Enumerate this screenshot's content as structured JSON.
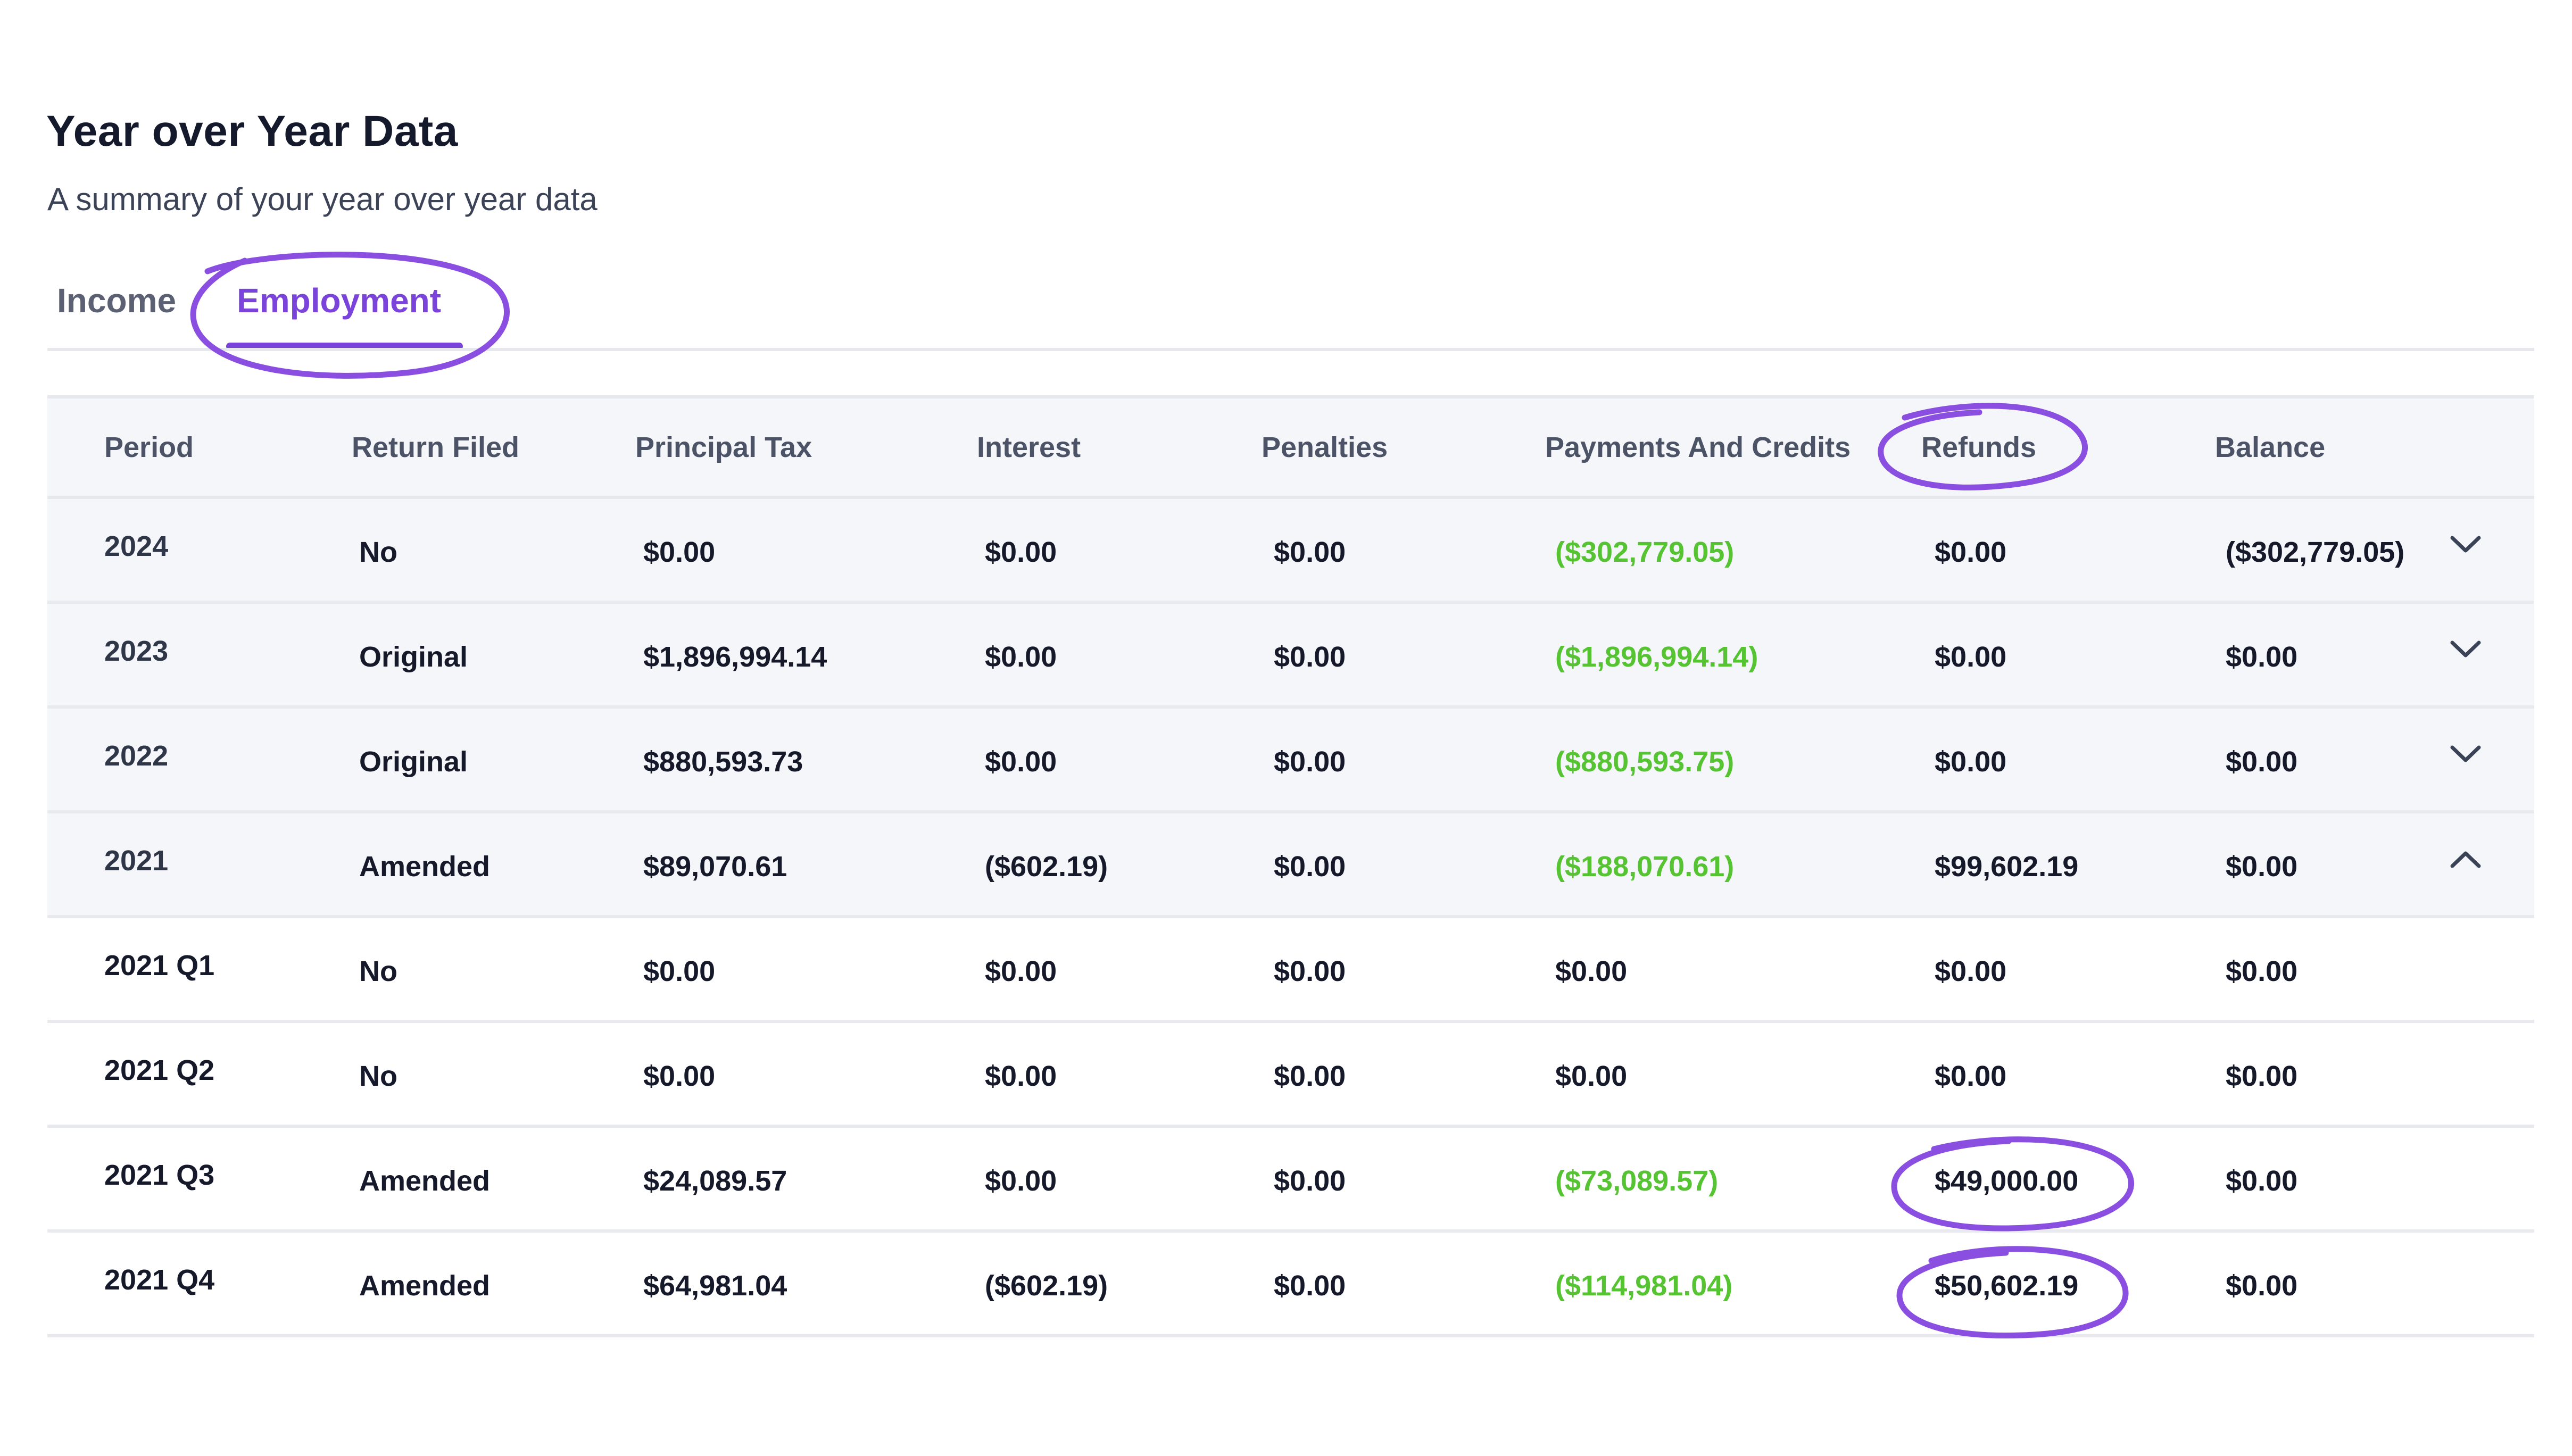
{
  "section": {
    "title": "Year over Year Data",
    "subtitle": "A summary of your year over year data"
  },
  "tabs": [
    {
      "label": "Income",
      "active": false
    },
    {
      "label": "Employment",
      "active": true
    }
  ],
  "colors": {
    "accent": "#7a44db",
    "credit_green": "#55c332",
    "annotation_circle": "#8a4fe0"
  },
  "table": {
    "columns": [
      "Period",
      "Return Filed",
      "Principal Tax",
      "Interest",
      "Penalties",
      "Payments And Credits",
      "Refunds",
      "Balance"
    ],
    "rows": [
      {
        "period": "2024",
        "return_filed": "No",
        "principal_tax": "$0.00",
        "interest": "$0.00",
        "penalties": "$0.00",
        "payments_credits": "($302,779.05)",
        "refunds": "$0.00",
        "balance": "($302,779.05)",
        "expander": "chevron-down-icon"
      },
      {
        "period": "2023",
        "return_filed": "Original",
        "principal_tax": "$1,896,994.14",
        "interest": "$0.00",
        "penalties": "$0.00",
        "payments_credits": "($1,896,994.14)",
        "refunds": "$0.00",
        "balance": "$0.00",
        "expander": "chevron-down-icon"
      },
      {
        "period": "2022",
        "return_filed": "Original",
        "principal_tax": "$880,593.73",
        "interest": "$0.00",
        "penalties": "$0.00",
        "payments_credits": "($880,593.75)",
        "refunds": "$0.00",
        "balance": "$0.00",
        "expander": "chevron-down-icon"
      },
      {
        "period": "2021",
        "return_filed": "Amended",
        "principal_tax": "$89,070.61",
        "interest": "($602.19)",
        "penalties": "$0.00",
        "payments_credits": "($188,070.61)",
        "refunds": "$99,602.19",
        "balance": "$0.00",
        "expander": "chevron-up-icon"
      },
      {
        "period": "2021 Q1",
        "return_filed": "No",
        "principal_tax": "$0.00",
        "interest": "$0.00",
        "penalties": "$0.00",
        "payments_credits": "$0.00",
        "refunds": "$0.00",
        "balance": "$0.00"
      },
      {
        "period": "2021 Q2",
        "return_filed": "No",
        "principal_tax": "$0.00",
        "interest": "$0.00",
        "penalties": "$0.00",
        "payments_credits": "$0.00",
        "refunds": "$0.00",
        "balance": "$0.00"
      },
      {
        "period": "2021 Q3",
        "return_filed": "Amended",
        "principal_tax": "$24,089.57",
        "interest": "$0.00",
        "penalties": "$0.00",
        "payments_credits": "($73,089.57)",
        "refunds": "$49,000.00",
        "balance": "$0.00"
      },
      {
        "period": "2021 Q4",
        "return_filed": "Amended",
        "principal_tax": "$64,981.04",
        "interest": "($602.19)",
        "penalties": "$0.00",
        "payments_credits": "($114,981.04)",
        "refunds": "$50,602.19",
        "balance": "$0.00"
      }
    ]
  }
}
